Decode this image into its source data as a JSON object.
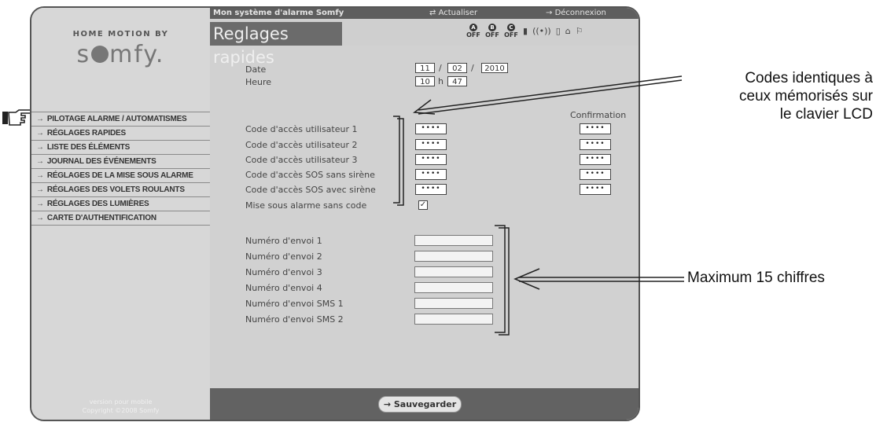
{
  "topbar": {
    "system_title": "Mon système d'alarme Somfy",
    "refresh": "Actualiser",
    "logout": "Déconnexion"
  },
  "brand": {
    "top": "HOME MOTION BY",
    "logo_pre": "s",
    "logo_post": "mfy."
  },
  "page_title": "Reglages rapides",
  "status": {
    "zones": [
      {
        "letter": "A",
        "state": "OFF"
      },
      {
        "letter": "B",
        "state": "OFF"
      },
      {
        "letter": "C",
        "state": "OFF"
      }
    ]
  },
  "sidebar": {
    "items": [
      {
        "label": "PILOTAGE ALARME / AUTOMATISMES"
      },
      {
        "label": "RÉGLAGES RAPIDES"
      },
      {
        "label": "LISTE DES ÉLÉMENTS"
      },
      {
        "label": "JOURNAL DES ÉVÉNEMENTS"
      },
      {
        "label": "RÉGLAGES DE LA MISE SOUS ALARME"
      },
      {
        "label": "RÉGLAGES DES VOLETS ROULANTS"
      },
      {
        "label": "RÉGLAGES DES LUMIÈRES"
      },
      {
        "label": "CARTE D'AUTHENTIFICATION"
      }
    ],
    "footer_line1": "version pour mobile",
    "footer_line2": "Copyright ©2008 Somfy"
  },
  "form": {
    "date_label": "Date",
    "date": {
      "day": "11",
      "month": "02",
      "year": "2010",
      "sep": "/"
    },
    "time_label": "Heure",
    "time": {
      "hour": "10",
      "sep": "h",
      "minute": "47"
    },
    "confirmation_label": "Confirmation",
    "codes": [
      {
        "label": "Code d'accès utilisateur 1",
        "value": "••••",
        "confirm": "••••"
      },
      {
        "label": "Code d'accès utilisateur 2",
        "value": "••••",
        "confirm": "••••"
      },
      {
        "label": "Code d'accès utilisateur 3",
        "value": "••••",
        "confirm": "••••"
      },
      {
        "label": "Code d'accès SOS sans sirène",
        "value": "••••",
        "confirm": "••••"
      },
      {
        "label": "Code d'accès SOS avec sirène",
        "value": "••••",
        "confirm": "••••"
      }
    ],
    "arm_without_code_label": "Mise sous alarme sans code",
    "arm_without_code_checked": "✓",
    "numbers": [
      {
        "label": "Numéro d'envoi 1",
        "value": ""
      },
      {
        "label": "Numéro d'envoi 2",
        "value": ""
      },
      {
        "label": "Numéro d'envoi 3",
        "value": ""
      },
      {
        "label": "Numéro d'envoi 4",
        "value": ""
      },
      {
        "label": "Numéro d'envoi SMS 1",
        "value": ""
      },
      {
        "label": "Numéro d'envoi SMS 2",
        "value": ""
      }
    ],
    "save_label": "Sauvegarder"
  },
  "annotations": {
    "codes_line1": "Codes identiques à",
    "codes_line2": "ceux mémorisés sur",
    "codes_line3": "le clavier LCD",
    "max": "Maximum 15 chiffres"
  }
}
